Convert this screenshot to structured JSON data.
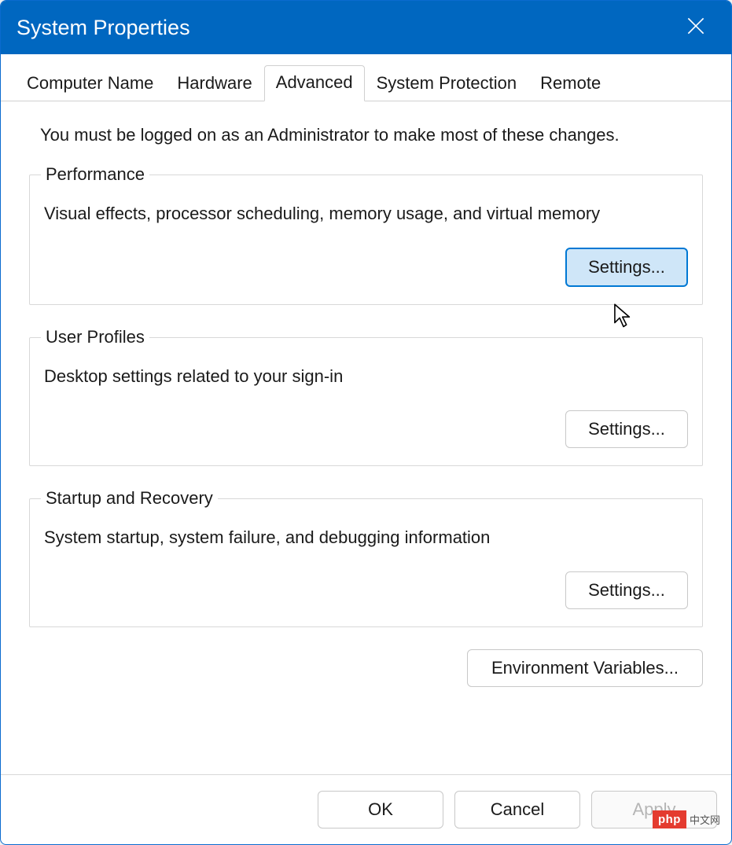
{
  "window": {
    "title": "System Properties"
  },
  "tabs": {
    "items": [
      {
        "label": "Computer Name",
        "active": false
      },
      {
        "label": "Hardware",
        "active": false
      },
      {
        "label": "Advanced",
        "active": true
      },
      {
        "label": "System Protection",
        "active": false
      },
      {
        "label": "Remote",
        "active": false
      }
    ]
  },
  "content": {
    "intro": "You must be logged on as an Administrator to make most of these changes.",
    "performance": {
      "legend": "Performance",
      "desc": "Visual effects, processor scheduling, memory usage, and virtual memory",
      "button": "Settings..."
    },
    "user_profiles": {
      "legend": "User Profiles",
      "desc": "Desktop settings related to your sign-in",
      "button": "Settings..."
    },
    "startup": {
      "legend": "Startup and Recovery",
      "desc": "System startup, system failure, and debugging information",
      "button": "Settings..."
    },
    "env_button": "Environment Variables..."
  },
  "footer": {
    "ok": "OK",
    "cancel": "Cancel",
    "apply": "Apply"
  },
  "watermark": {
    "logo": "php",
    "text": "中文网"
  }
}
